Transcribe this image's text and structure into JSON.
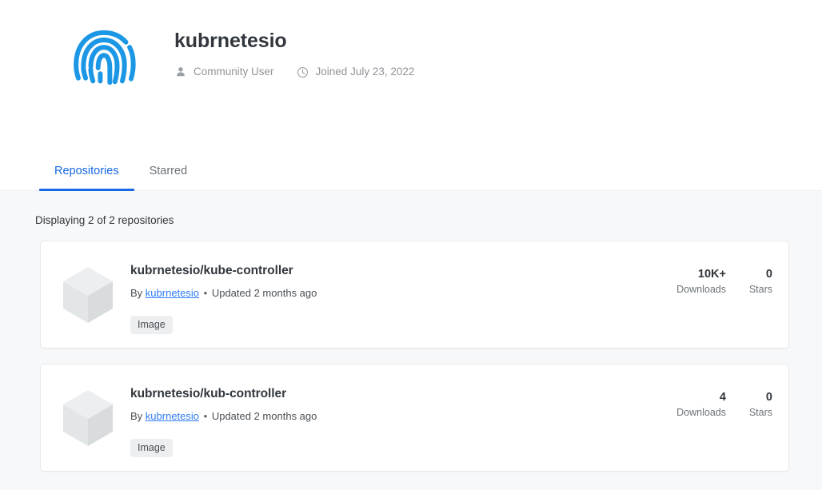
{
  "profile": {
    "logo_icon": "fingerprint-icon",
    "logo_color": "#1b97e5",
    "name": "kubrnetesio",
    "meta": [
      {
        "icon": "person-icon",
        "text": "Community User"
      },
      {
        "icon": "clock-icon",
        "text": "Joined July 23, 2022"
      }
    ]
  },
  "tabs": [
    {
      "label": "Repositories",
      "active": true
    },
    {
      "label": "Starred",
      "active": false
    }
  ],
  "accent_color": "#1668e3",
  "content": {
    "displaying_text": "Displaying 2 of 2 repositories",
    "repositories": [
      {
        "thumb_icon": "cube-icon",
        "title": "kubrnetesio/kube-controller",
        "by_prefix": "By",
        "owner": "kubrnetesio",
        "separator": "•",
        "updated": "Updated 2 months ago",
        "badges": [
          "Image"
        ],
        "stats": [
          {
            "value": "10K+",
            "label": "Downloads"
          },
          {
            "value": "0",
            "label": "Stars"
          }
        ]
      },
      {
        "thumb_icon": "cube-icon",
        "title": "kubrnetesio/kub-controller",
        "by_prefix": "By",
        "owner": "kubrnetesio",
        "separator": "•",
        "updated": "Updated 2 months ago",
        "badges": [
          "Image"
        ],
        "stats": [
          {
            "value": "4",
            "label": "Downloads"
          },
          {
            "value": "0",
            "label": "Stars"
          }
        ]
      }
    ]
  }
}
